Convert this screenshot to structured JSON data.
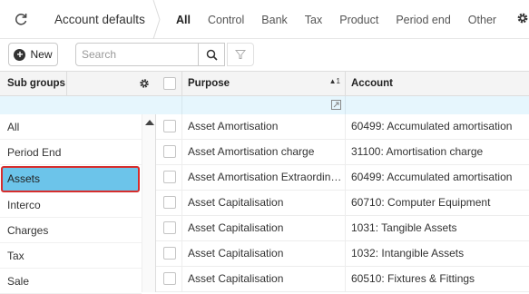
{
  "header": {
    "title": "Account defaults",
    "tabs": [
      {
        "label": "All",
        "active": true
      },
      {
        "label": "Control",
        "active": false
      },
      {
        "label": "Bank",
        "active": false
      },
      {
        "label": "Tax",
        "active": false
      },
      {
        "label": "Product",
        "active": false
      },
      {
        "label": "Period end",
        "active": false
      },
      {
        "label": "Other",
        "active": false
      }
    ],
    "icons": [
      "refresh-icon",
      "gear-icon"
    ]
  },
  "toolbar": {
    "new_label": "New",
    "search_placeholder": "Search",
    "icons": [
      "plus-circle-icon",
      "search-icon",
      "filter-icon"
    ]
  },
  "subgroups": {
    "header": "Sub groups",
    "items": [
      {
        "label": "All",
        "selected": false
      },
      {
        "label": "Period End",
        "selected": false
      },
      {
        "label": "Assets",
        "selected": true
      },
      {
        "label": "Interco",
        "selected": false
      },
      {
        "label": "Charges",
        "selected": false
      },
      {
        "label": "Tax",
        "selected": false
      },
      {
        "label": "Sale",
        "selected": false
      }
    ]
  },
  "grid": {
    "columns": {
      "purpose": "Purpose",
      "account": "Account"
    },
    "sort_index": "1",
    "rows": [
      {
        "purpose": "Asset Amortisation",
        "account": "60499: Accumulated amortisation"
      },
      {
        "purpose": "Asset Amortisation charge",
        "account": "31100: Amortisation charge"
      },
      {
        "purpose": "Asset Amortisation Extraordina...",
        "account": "60499: Accumulated amortisation"
      },
      {
        "purpose": "Asset Capitalisation",
        "account": "60710: Computer Equipment"
      },
      {
        "purpose": "Asset Capitalisation",
        "account": "1031: Tangible Assets"
      },
      {
        "purpose": "Asset Capitalisation",
        "account": "1032: Intangible Assets"
      },
      {
        "purpose": "Asset Capitalisation",
        "account": "60510: Fixtures & Fittings"
      }
    ]
  },
  "colors": {
    "selected_bg": "#6cc4ea",
    "selected_border": "#d62d2d",
    "filter_row_bg": "#e6f6fd"
  }
}
